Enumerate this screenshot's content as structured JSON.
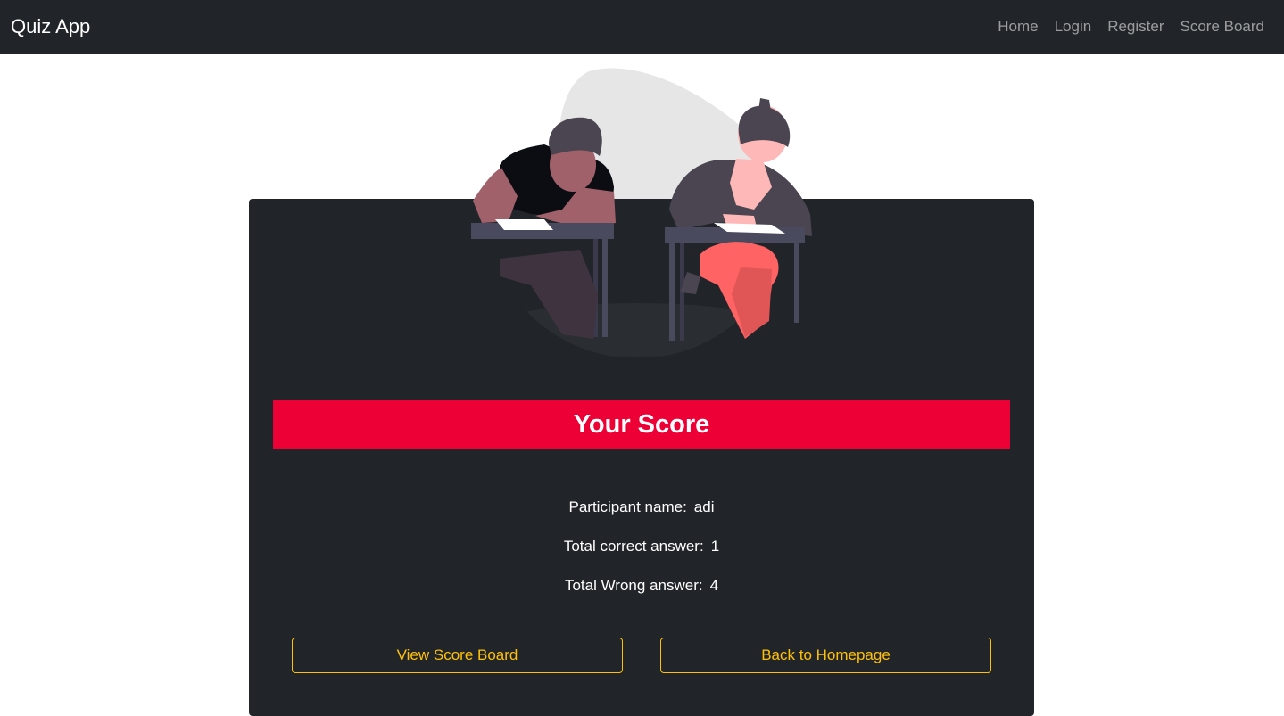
{
  "navbar": {
    "brand": "Quiz App",
    "links": [
      "Home",
      "Login",
      "Register",
      "Score Board"
    ]
  },
  "score": {
    "title": "Your Score",
    "participant_label": "Participant name:",
    "participant_value": "adi",
    "correct_label": "Total correct answer:",
    "correct_value": "1",
    "wrong_label": "Total Wrong answer:",
    "wrong_value": "4"
  },
  "buttons": {
    "view_score_board": "View Score Board",
    "back_home": "Back to Homepage"
  },
  "colors": {
    "navbar_bg": "#212529",
    "card_bg": "#212529",
    "banner": "#ed0035",
    "button_accent": "#ffc107"
  },
  "illustration": {
    "icon": "students-taking-exam-illustration"
  }
}
